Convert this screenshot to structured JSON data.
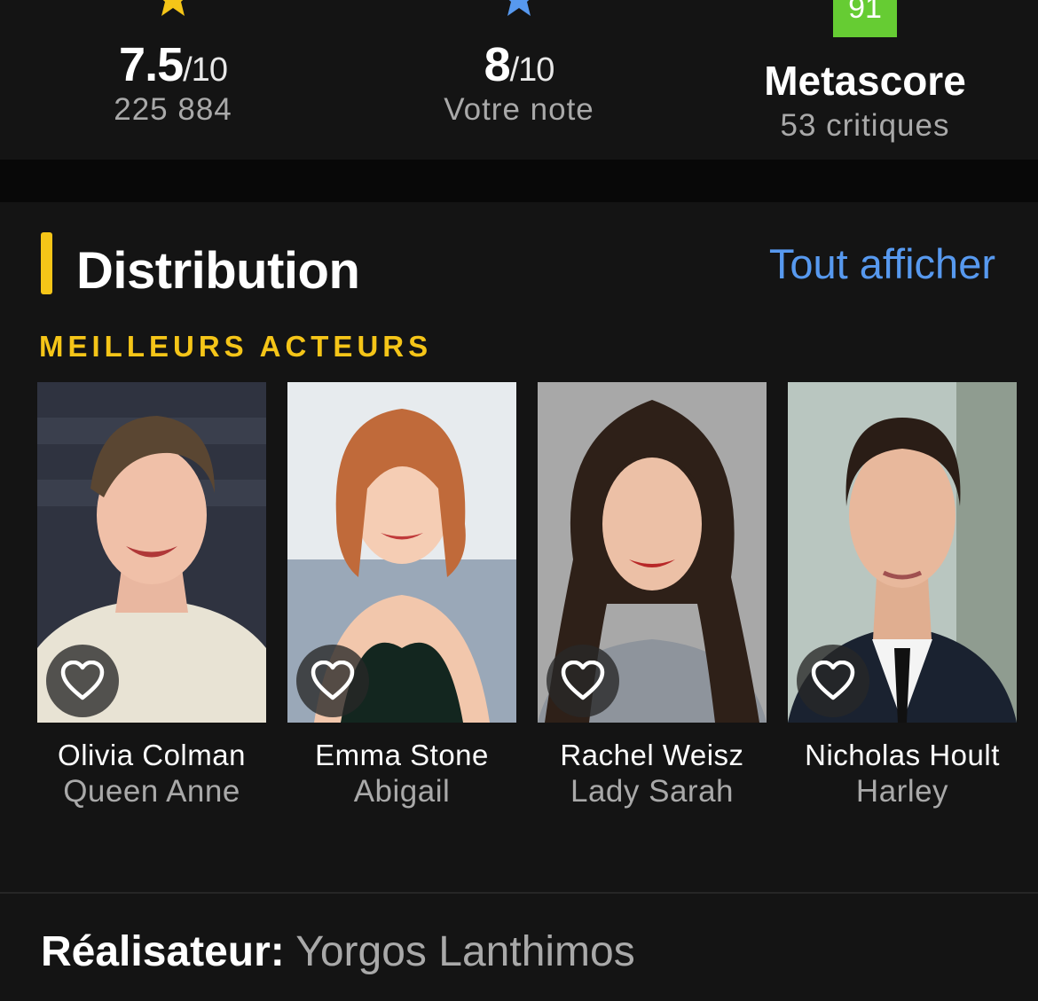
{
  "ratings": {
    "imdb": {
      "score": "7.5",
      "out_of": "/10",
      "votes": "225 884"
    },
    "user": {
      "score": "8",
      "out_of": "/10",
      "label": "Votre note"
    },
    "meta": {
      "score": "91",
      "title": "Metascore",
      "critics": "53 critiques"
    }
  },
  "colors": {
    "imdb_yellow": "#f5c518",
    "user_blue": "#5799ef",
    "metascore_green": "#66cc33"
  },
  "cast": {
    "title": "Distribution",
    "see_all": "Tout afficher",
    "subhead": "MEILLEURS ACTEURS",
    "members": [
      {
        "name": "Olivia Colman",
        "role": "Queen Anne"
      },
      {
        "name": "Emma Stone",
        "role": "Abigail"
      },
      {
        "name": "Rachel Weisz",
        "role": "Lady Sarah"
      },
      {
        "name": "Nicholas Hoult",
        "role": "Harley"
      }
    ]
  },
  "director": {
    "label": "Réalisateur:",
    "name": "Yorgos Lanthimos"
  },
  "icons": [
    "star-icon",
    "heart-outline-icon"
  ]
}
